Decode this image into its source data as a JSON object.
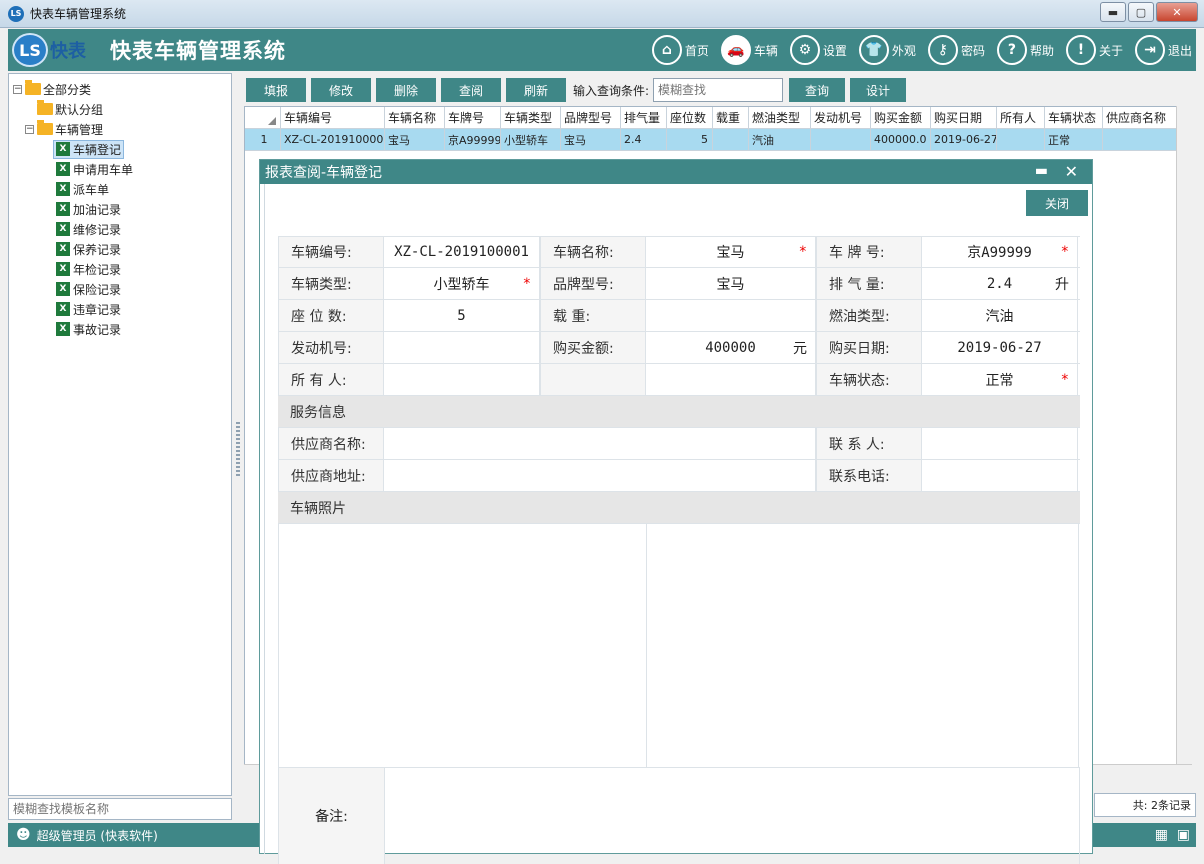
{
  "window": {
    "title": "快表车辆管理系统",
    "min": "▬",
    "max": "▢",
    "close": "✕"
  },
  "header": {
    "logo_mark": "LS",
    "logo_text": "快表",
    "system_name": "快表车辆管理系统",
    "nav": [
      {
        "label": "首页",
        "icon": "⌂"
      },
      {
        "label": "车辆",
        "icon": "🚗"
      },
      {
        "label": "设置",
        "icon": "⚙"
      },
      {
        "label": "外观",
        "icon": "👕"
      },
      {
        "label": "密码",
        "icon": "⚷"
      },
      {
        "label": "帮助",
        "icon": "?"
      },
      {
        "label": "关于",
        "icon": "!"
      },
      {
        "label": "退出",
        "icon": "⇥"
      }
    ]
  },
  "tree": {
    "root": "全部分类",
    "default_group": "默认分组",
    "vehicle_mgmt": "车辆管理",
    "items": [
      "车辆登记",
      "申请用车单",
      "派车单",
      "加油记录",
      "维修记录",
      "保养记录",
      "年检记录",
      "保险记录",
      "违章记录",
      "事故记录"
    ],
    "xl_glyph": "X"
  },
  "left_search_placeholder": "模糊查找模板名称",
  "toolbar": {
    "buttons": [
      "填报",
      "修改",
      "删除",
      "查阅",
      "刷新"
    ],
    "query_label": "输入查询条件:",
    "query_placeholder": "模糊查找",
    "query_button": "查询",
    "design_button": "设计"
  },
  "grid": {
    "columns": [
      "车辆编号",
      "车辆名称",
      "车牌号",
      "车辆类型",
      "品牌型号",
      "排气量",
      "座位数",
      "载重",
      "燃油类型",
      "发动机号",
      "购买金额",
      "购买日期",
      "所有人",
      "车辆状态",
      "供应商名称"
    ],
    "rows": [
      [
        "1",
        "XZ-CL-2019100001",
        "宝马",
        "京A99999",
        "小型轿车",
        "宝马",
        "2.4",
        "5",
        "",
        "汽油",
        "",
        "400000.0",
        "2019-06-27",
        "",
        "正常",
        ""
      ]
    ]
  },
  "footer_count": "共: 2条记录",
  "status": {
    "user": "超级管理员 (快表软件)"
  },
  "dialog": {
    "title": "报表查阅-车辆登记",
    "close_button": "关闭",
    "min_glyph": "▬",
    "close_glyph": "✕",
    "labels": {
      "vehicle_no": "车辆编号:",
      "vehicle_name": "车辆名称:",
      "plate": "车 牌 号:",
      "type": "车辆类型:",
      "brand": "品牌型号:",
      "displacement": "排 气 量:",
      "seats": "座 位 数:",
      "load": "载    重:",
      "fuel": "燃油类型:",
      "engine": "发动机号:",
      "amount": "购买金额:",
      "date": "购买日期:",
      "owner": "所 有 人:",
      "status": "车辆状态:",
      "service_section": "服务信息",
      "supplier_name": "供应商名称:",
      "contact": "联 系 人:",
      "supplier_addr": "供应商地址:",
      "phone": "联系电话:",
      "photo_section": "车辆照片",
      "remark": "备注:"
    },
    "values": {
      "vehicle_no": "XZ-CL-2019100001",
      "vehicle_name": "宝马",
      "plate": "京A99999",
      "type": "小型轿车",
      "brand": "宝马",
      "displacement": "2.4",
      "displacement_unit": "升",
      "seats": "5",
      "load": "",
      "fuel": "汽油",
      "engine": "",
      "amount": "400000",
      "amount_unit": "元",
      "date": "2019-06-27",
      "owner": "",
      "status": "正常"
    },
    "required_mark": "*"
  }
}
